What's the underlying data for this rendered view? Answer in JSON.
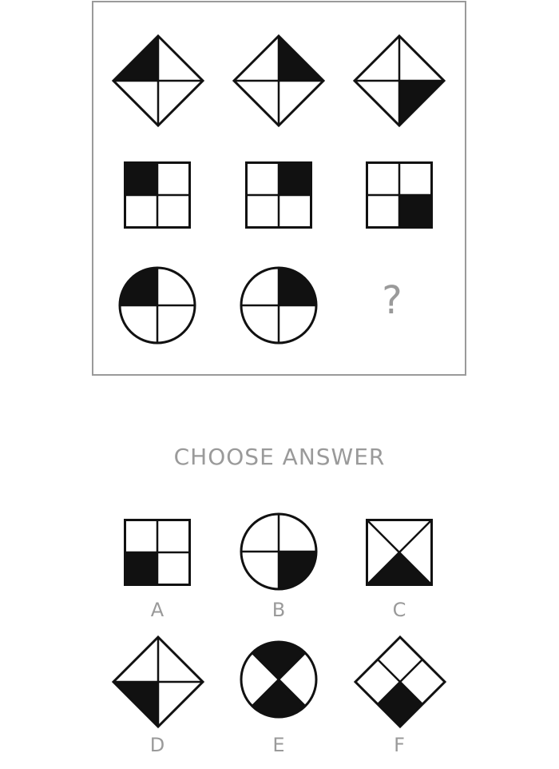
{
  "puzzle": {
    "missing_cell_symbol": "?",
    "rows": [
      {
        "shape": "diamond",
        "cells": [
          "top-left",
          "top-right",
          "bottom-right"
        ]
      },
      {
        "shape": "square",
        "cells": [
          "top-left",
          "top-right",
          "bottom-right"
        ]
      },
      {
        "shape": "circle",
        "cells": [
          "top-left",
          "top-right"
        ]
      }
    ]
  },
  "heading": "CHOOSE ANSWER",
  "options": [
    {
      "letter": "A",
      "shape": "square",
      "filled": "bottom-left"
    },
    {
      "letter": "B",
      "shape": "circle",
      "filled": "bottom-right"
    },
    {
      "letter": "C",
      "shape": "square-x",
      "filled": "bottom-triangle"
    },
    {
      "letter": "D",
      "shape": "diamond",
      "filled": "bottom-left"
    },
    {
      "letter": "E",
      "shape": "circle-x",
      "filled": "top-and-bottom-wedges"
    },
    {
      "letter": "F",
      "shape": "diamond-grid",
      "filled": "bottom-cell"
    }
  ],
  "colors": {
    "stroke": "#111111",
    "fill": "#111111",
    "muted_text": "#9a9a9a",
    "frame": "#9a9a9a"
  }
}
